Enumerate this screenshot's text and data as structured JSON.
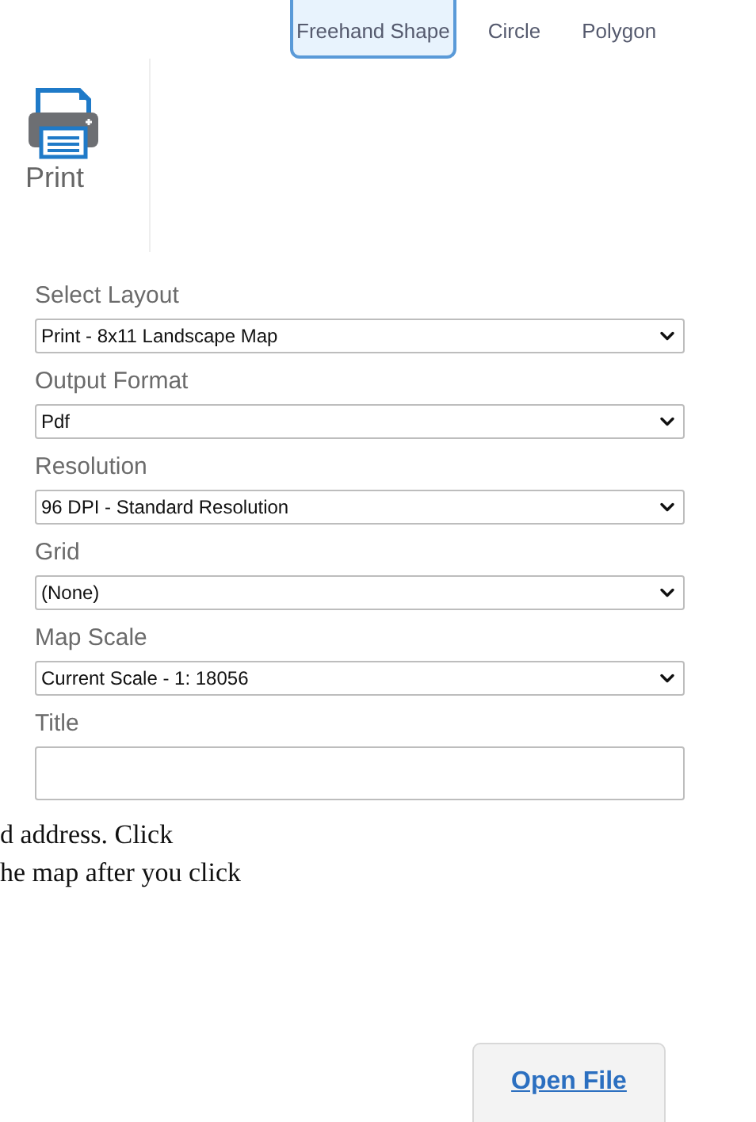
{
  "draw_tools": [
    {
      "label": "Freehand Shape",
      "selected": true
    },
    {
      "label": "Circle",
      "selected": false
    },
    {
      "label": "Polygon",
      "selected": false
    }
  ],
  "print_tool": {
    "label": "Print"
  },
  "fields": [
    {
      "kind": "select",
      "label": "Select Layout",
      "value": "Print - 8x11 Landscape Map"
    },
    {
      "kind": "select",
      "label": "Output Format",
      "value": "Pdf"
    },
    {
      "kind": "select",
      "label": "Resolution",
      "value": "96 DPI - Standard Resolution"
    },
    {
      "kind": "select",
      "label": "Grid",
      "value": "(None)"
    },
    {
      "kind": "select",
      "label": "Map Scale",
      "value": "Current Scale - 1: 18056"
    },
    {
      "kind": "text",
      "label": "Title"
    }
  ],
  "instructions": [
    "d address. Click",
    "he map after you click"
  ],
  "open_file_button": "Open File"
}
